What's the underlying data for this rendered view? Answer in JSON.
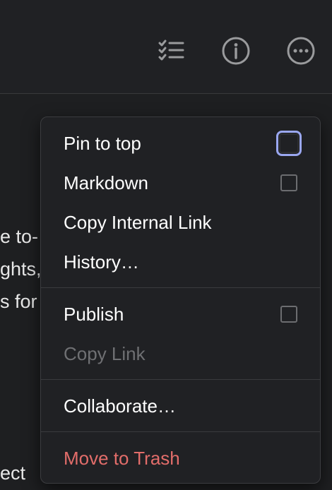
{
  "toolbar": {
    "icons": [
      {
        "name": "checklist-icon"
      },
      {
        "name": "info-icon"
      },
      {
        "name": "more-icon"
      }
    ]
  },
  "background_text": {
    "line1": "e to-",
    "line2": "ghts,",
    "line3": "s for",
    "line4": "ect"
  },
  "menu": {
    "pin_to_top": {
      "label": "Pin to top",
      "checked": false
    },
    "markdown": {
      "label": "Markdown",
      "checked": false
    },
    "copy_internal_link": {
      "label": "Copy Internal Link"
    },
    "history": {
      "label": "History…"
    },
    "publish": {
      "label": "Publish",
      "checked": false
    },
    "copy_link": {
      "label": "Copy Link",
      "disabled": true
    },
    "collaborate": {
      "label": "Collaborate…"
    },
    "move_to_trash": {
      "label": "Move to Trash",
      "color": "#e26d6a"
    }
  },
  "colors": {
    "background": "#1e1f21",
    "menu_background": "#202124",
    "focus_ring": "#9aa7f0",
    "danger": "#e26d6a",
    "disabled_text": "#6f7073"
  }
}
